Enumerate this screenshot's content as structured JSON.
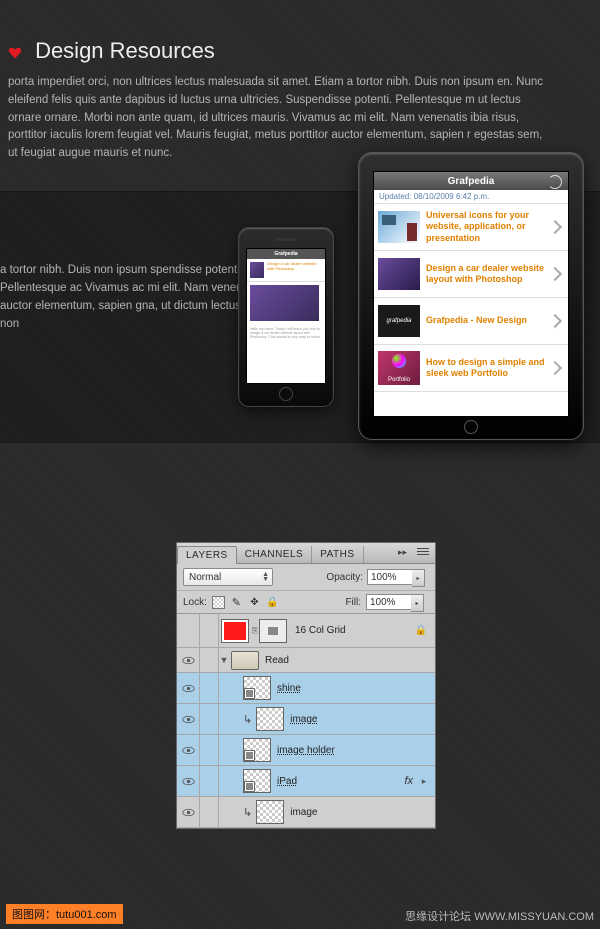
{
  "header": {
    "title": "Design Resources",
    "intro": "porta imperdiet orci, non ultrices lectus malesuada sit amet. Etiam a tortor nibh. Duis non ipsum en. Nunc eleifend felis quis ante dapibus id luctus urna ultricies. Suspendisse potenti. Pellentesque m ut lectus ornare ornare. Morbi non ante quam, id ultrices mauris. Vivamus ac mi elit. Nam venenatis ibia risus, porttitor iaculis lorem feugiat vel. Mauris feugiat, metus porttitor auctor elementum, sapien r egestas sem, ut feugiat augue mauris et nunc."
  },
  "band_text": "a tortor nibh. Duis non ipsum spendisse potenti. Pellentesque ac Vivamus ac mi elit. Nam venenatis porttitor auctor elementum, sapien gna, ut dictum lectus. Quisque non",
  "ipad": {
    "nav_title": "Grafpedia",
    "updated": "Updated: 08/10/2009 6:42 p.m.",
    "rows": [
      "Universal icons for your website, application, or presentation",
      "Design a car dealer website layout with Photoshop",
      "Grafpedia - New Design",
      "How to design a simple and sleek web Portfolio"
    ],
    "t3_label": "grafpedia",
    "t4_label": "Portfolio"
  },
  "iphone": {
    "nav_title": "Grafpedia",
    "row_text": "Design a car dealer website with Photoshop",
    "body_text": "Hello my friend. Today I will teach you how to design a car dealer website layout with Photoshop. This tutorial is very easy to follow."
  },
  "layers": {
    "tabs": [
      "LAYERS",
      "CHANNELS",
      "PATHS"
    ],
    "blend": "Normal",
    "opacity_lbl": "Opacity:",
    "opacity_val": "100%",
    "lock_lbl": "Lock:",
    "fill_lbl": "Fill:",
    "fill_val": "100%",
    "items": [
      {
        "name": "16 Col Grid"
      },
      {
        "name": "Read"
      },
      {
        "name": "shine"
      },
      {
        "name": "image"
      },
      {
        "name": "image holder"
      },
      {
        "name": "iPad"
      },
      {
        "name": "image"
      }
    ],
    "fx": "fx"
  },
  "watermark_left": "图图网：tutu001.com",
  "watermark_right": "思缘设计论坛  WWW.MISSYUAN.COM"
}
